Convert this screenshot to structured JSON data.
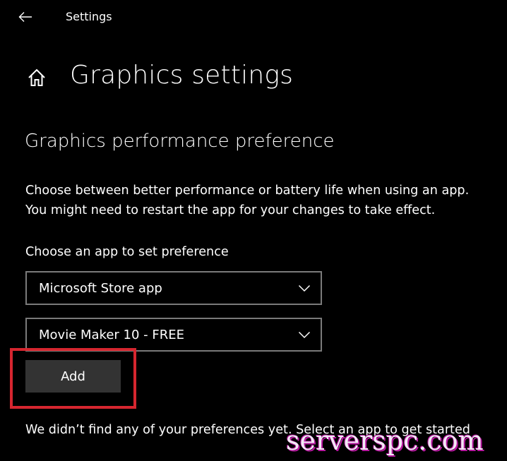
{
  "window": {
    "title": "Settings"
  },
  "icons": {
    "back": "back-arrow-icon",
    "home": "home-icon",
    "chevron": "chevron-down-icon"
  },
  "page": {
    "title": "Graphics settings"
  },
  "section": {
    "title": "Graphics performance preference"
  },
  "description": {
    "line1": "Choose between better performance or battery life when using an app.",
    "line2": "You might need to restart the app for your changes to take effect."
  },
  "chooser": {
    "label": "Choose an app to set preference",
    "app_type_value": "Microsoft Store app",
    "app_value": "Movie Maker 10 - FREE",
    "add_label": "Add"
  },
  "empty_message": "We didn’t find any of your preferences yet. Select an app to get started",
  "watermark": "serverspc.com",
  "colors": {
    "background": "#000000",
    "button": "#333333",
    "highlight": "#d6262f",
    "border": "#7a7a7a"
  }
}
